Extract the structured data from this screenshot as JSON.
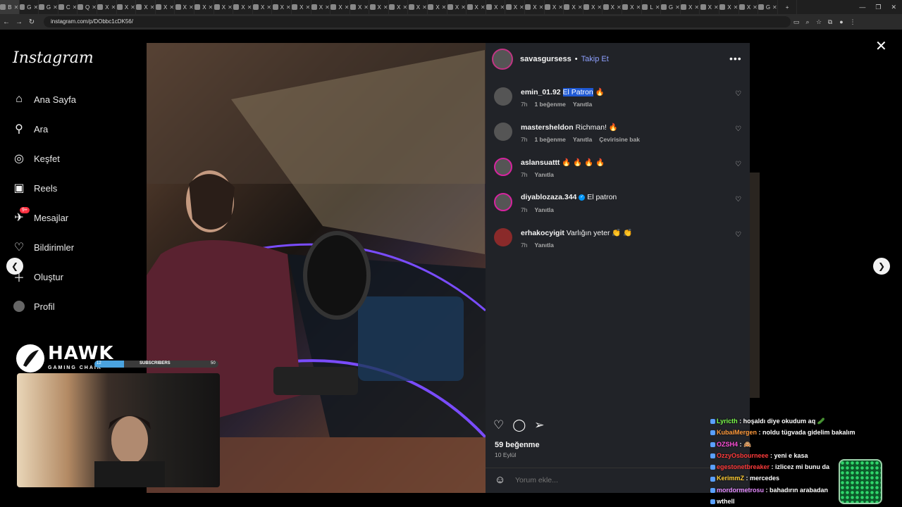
{
  "browser": {
    "url": "instagram.com/p/DObbc1cDK56/",
    "tabs": [
      "B",
      "G",
      "G",
      "C",
      "Q",
      "X",
      "X",
      "X",
      "X",
      "X",
      "X",
      "X",
      "X",
      "X",
      "X",
      "X",
      "X",
      "X",
      "X",
      "X",
      "X",
      "X",
      "X",
      "X",
      "X",
      "X",
      "X",
      "X",
      "X",
      "X",
      "X",
      "X",
      "X",
      "L",
      "G",
      "X",
      "X",
      "X",
      "X",
      "G"
    ]
  },
  "sidebar": {
    "logo": "Instagram",
    "items": [
      {
        "label": "Ana Sayfa",
        "icon": "home-icon"
      },
      {
        "label": "Ara",
        "icon": "search-icon"
      },
      {
        "label": "Keşfet",
        "icon": "compass-icon"
      },
      {
        "label": "Reels",
        "icon": "reels-icon"
      },
      {
        "label": "Mesajlar",
        "icon": "messenger-icon",
        "badge": "9+"
      },
      {
        "label": "Bildirimler",
        "icon": "heart-icon"
      },
      {
        "label": "Oluştur",
        "icon": "plus-icon"
      },
      {
        "label": "Profil",
        "icon": "avatar-icon"
      }
    ]
  },
  "post": {
    "author": "savasgursess",
    "follow_label": "Takip Et",
    "comments": [
      {
        "user": "emin_01.92",
        "text_highlight": "El Patron",
        "text": " 🔥",
        "time": "7h",
        "likes": "1 beğenme",
        "reply": "Yanıtla",
        "translate": ""
      },
      {
        "user": "mastersheldon",
        "text_highlight": "",
        "text": "Richman! 🔥",
        "time": "7h",
        "likes": "1 beğenme",
        "reply": "Yanıtla",
        "translate": "Çevirisine bak"
      },
      {
        "user": "aslansuattt",
        "text_highlight": "",
        "text": "🔥 🔥 🔥 🔥",
        "time": "7h",
        "likes": "",
        "reply": "Yanıtla",
        "translate": ""
      },
      {
        "user": "diyablozaza.344",
        "verified": true,
        "text_highlight": "",
        "text": "El patron",
        "time": "7h",
        "likes": "",
        "reply": "Yanıtla",
        "translate": ""
      },
      {
        "user": "erhakocyigit",
        "text_highlight": "",
        "text": "Varlığın yeter 👏 👏",
        "time": "7h",
        "likes": "",
        "reply": "Yanıtla",
        "translate": ""
      }
    ],
    "likes": "59 beğenme",
    "date": "10 Eylül",
    "comment_placeholder": "Yorum ekle..."
  },
  "stream": {
    "brand": "HAWK",
    "brand_sub": "GAMING CHAIR",
    "subs_left": "12",
    "subs_label": "SUBSCRIBERS",
    "subs_right": "50",
    "subs_progress": 0.24,
    "chat": [
      {
        "user": "Lyricth",
        "color": "#7cff4a",
        "msg": " : hoşaldı diye okudum aq 🥒"
      },
      {
        "user": "KubaiMergen",
        "color": "#ff9a3c",
        "msg": " : noldu tügvada gidelim bakalım"
      },
      {
        "user": "OZSH4",
        "color": "#ff4fd8",
        "msg": " : 🙈"
      },
      {
        "user": "OzzyOsbourneee",
        "color": "#ff3b3b",
        "msg": " : yeni e kasa"
      },
      {
        "user": "egestonetbreaker",
        "color": "#ff3b3b",
        "msg": " : izlicez mi bunu da"
      },
      {
        "user": "KerimmZ",
        "color": "#ffcc33",
        "msg": " : mercedes"
      },
      {
        "user": "mordormetrosu",
        "color": "#e58cff",
        "msg": " : bahadırın arabadan"
      },
      {
        "user": "wthell",
        "color": "#ffffff",
        "msg": ""
      }
    ]
  }
}
